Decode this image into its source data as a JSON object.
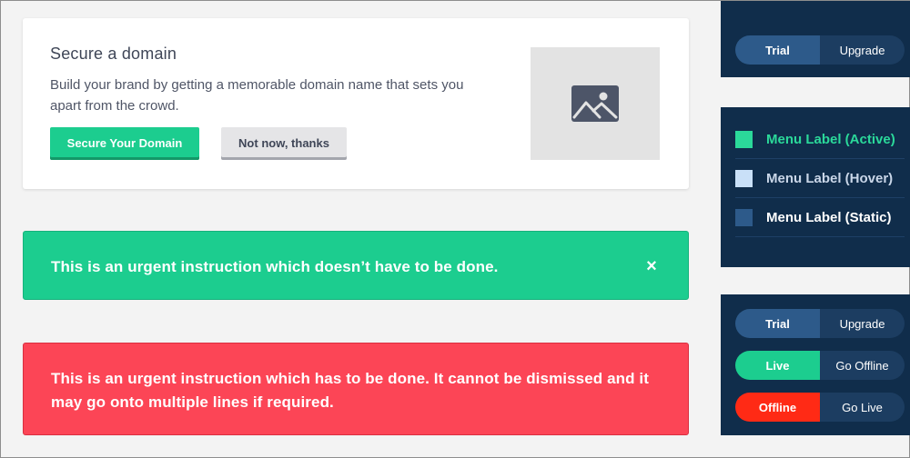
{
  "domain_card": {
    "title": "Secure a domain",
    "description": "Build your brand by getting a memorable domain name that sets you apart from the crowd.",
    "primary_button": "Secure Your Domain",
    "secondary_button": "Not now, thanks",
    "image_icon": "image-placeholder-icon"
  },
  "alerts": {
    "success": {
      "text": "This is an urgent instruction which doesn’t have to be done.",
      "close_icon": "×"
    },
    "danger": {
      "text": "This is an urgent instruction which has to be done. It cannot be dismissed and it may go onto multiple lines if required."
    }
  },
  "panel_top": {
    "toggle": {
      "left": "Trial",
      "right": "Upgrade"
    }
  },
  "menu": {
    "items": [
      {
        "label": "Menu Label (Active)",
        "color": "#2bd99a",
        "square": "#2bd99a"
      },
      {
        "label": "Menu Label (Hover)",
        "color": "#c9d6e8",
        "square": "#c9e0f8"
      },
      {
        "label": "Menu Label (Static)",
        "color": "#ffffff",
        "square": "#2d5a8a"
      }
    ]
  },
  "panel_bottom": {
    "toggles": [
      {
        "left": "Trial",
        "right": "Upgrade"
      },
      {
        "left": "Live",
        "right": "Go Offline"
      },
      {
        "left": "Offline",
        "right": "Go Live"
      }
    ]
  },
  "colors": {
    "accent_green": "#1ccd8f",
    "danger_red": "#fc4556",
    "navy": "#102d4b",
    "offline_red": "#ff2a15"
  }
}
